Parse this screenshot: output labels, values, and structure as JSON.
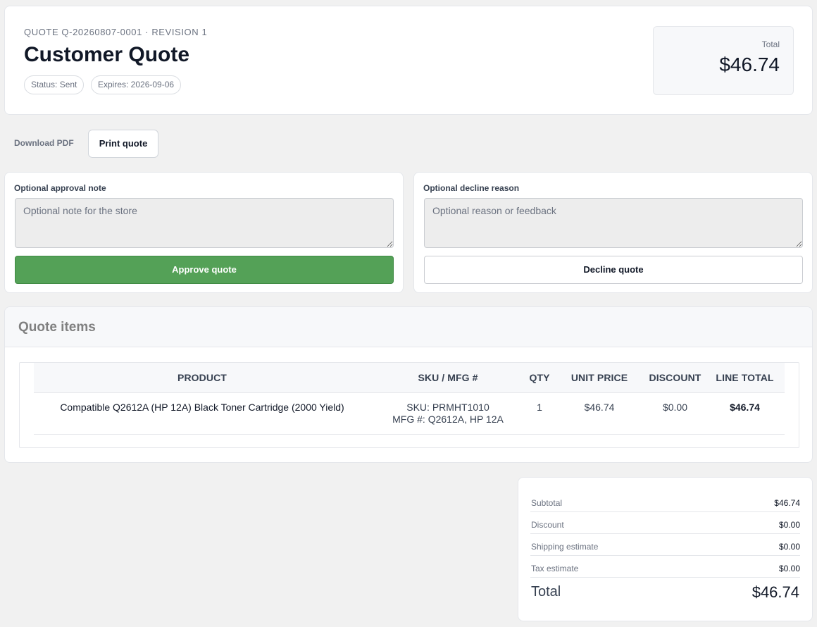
{
  "header": {
    "quote_ref": "QUOTE Q-20260807-0001 · REVISION 1",
    "title": "Customer Quote",
    "status_badge": "Status: Sent",
    "expires_badge": "Expires: 2026-09-06",
    "total_label": "Total",
    "total_value": "$46.74"
  },
  "actions": {
    "download_pdf": "Download PDF",
    "print_quote": "Print quote"
  },
  "approve": {
    "label": "Optional approval note",
    "placeholder": "Optional note for the store",
    "value": "",
    "button": "Approve quote"
  },
  "decline": {
    "label": "Optional decline reason",
    "placeholder": "Optional reason or feedback",
    "value": "",
    "button": "Decline quote"
  },
  "items": {
    "title": "Quote items",
    "columns": [
      "PRODUCT",
      "SKU / MFG #",
      "QTY",
      "UNIT PRICE",
      "DISCOUNT",
      "LINE TOTAL"
    ],
    "rows": [
      {
        "product": "Compatible Q2612A (HP 12A) Black Toner Cartridge (2000 Yield)",
        "sku": "SKU: PRMHT1010",
        "mfg": "MFG #: Q2612A, HP 12A",
        "qty": "1",
        "unit_price": "$46.74",
        "discount": "$0.00",
        "line_total": "$46.74"
      }
    ]
  },
  "summary": {
    "rows": [
      {
        "label": "Subtotal",
        "value": "$46.74"
      },
      {
        "label": "Discount",
        "value": "$0.00"
      },
      {
        "label": "Shipping estimate",
        "value": "$0.00"
      },
      {
        "label": "Tax estimate",
        "value": "$0.00"
      }
    ],
    "total_label": "Total",
    "total_value": "$46.74"
  },
  "colors": {
    "page_bg": "#f1f1f1",
    "approve_green": "#54a157",
    "border": "#e5e7eb"
  }
}
